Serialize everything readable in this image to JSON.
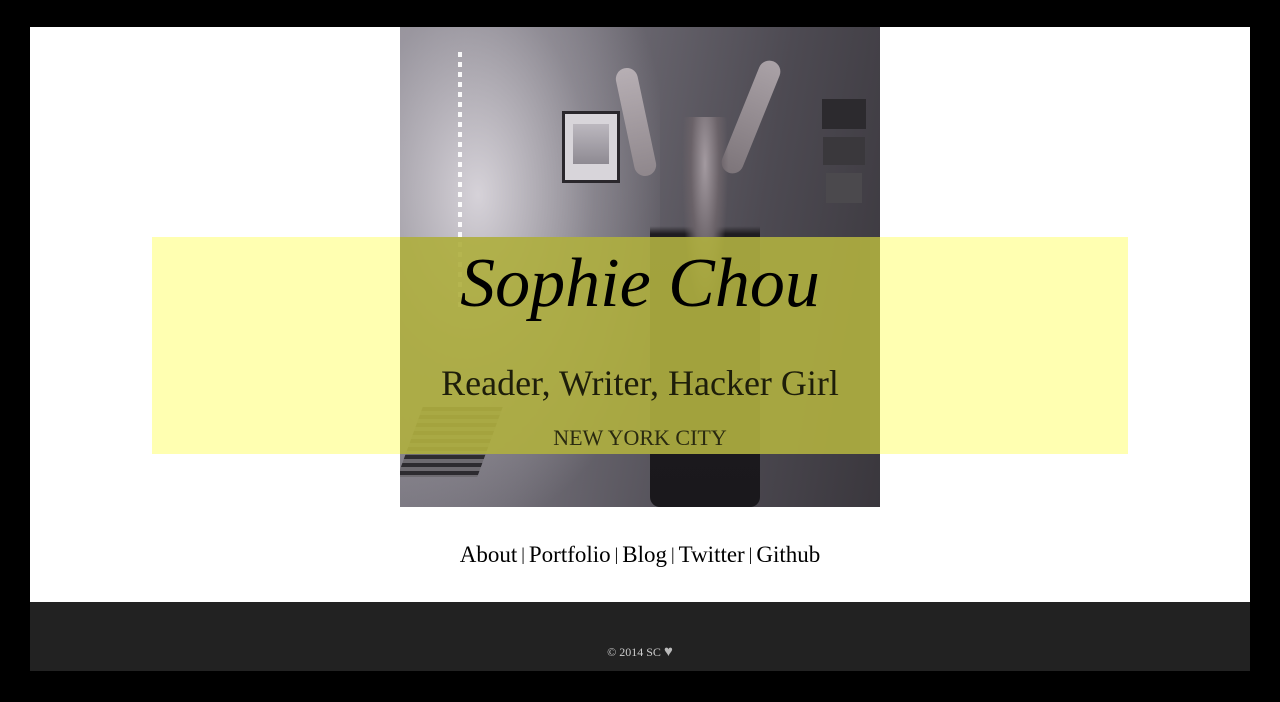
{
  "header": {
    "name": "Sophie Chou",
    "tagline": "Reader, Writer, Hacker Girl",
    "location": "NEW YORK CITY"
  },
  "nav": {
    "items": [
      "About",
      "Portfolio",
      "Blog",
      "Twitter",
      "Github"
    ],
    "separator": "|"
  },
  "footer": {
    "copyright": "© 2014 SC",
    "heart_icon": "♥"
  },
  "colors": {
    "page_border": "#000000",
    "banner": "#ffffa0",
    "footer": "#222222"
  }
}
